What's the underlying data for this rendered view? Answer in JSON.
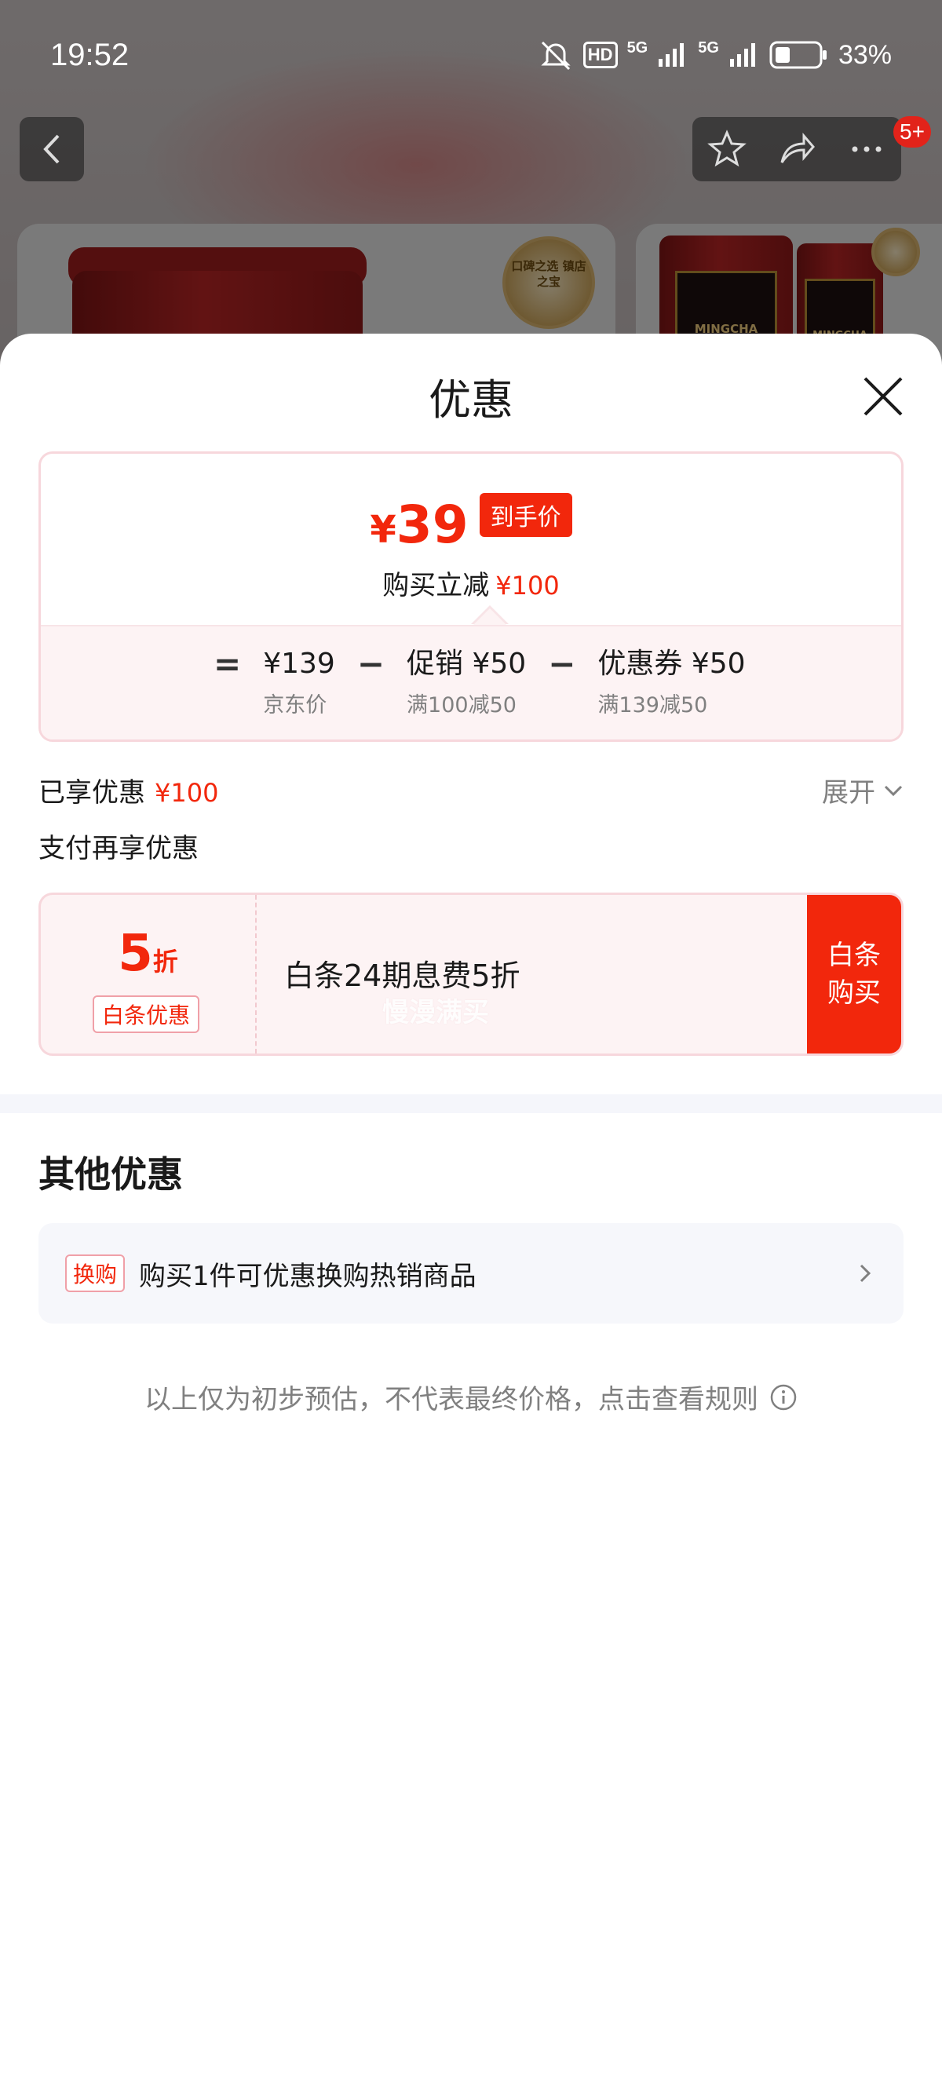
{
  "status_bar": {
    "time": "19:52",
    "battery": "33%",
    "network1": "5G",
    "network2": "5G",
    "hd": "HD"
  },
  "nav": {
    "badge": "5+"
  },
  "background": {
    "badge_text": "口碑之选 镇店之宝",
    "tin_label": "MINGCHA"
  },
  "sheet": {
    "title": "优惠",
    "price_card": {
      "final_yen": "¥",
      "final_value": "39",
      "final_tag": "到手价",
      "reduce_label": "购买立减",
      "reduce_value": "¥100",
      "op_equals": "=",
      "op_minus": "−",
      "terms": [
        {
          "main": "¥139",
          "sub": "京东价"
        },
        {
          "main": "促销 ¥50",
          "sub": "满100减50"
        },
        {
          "main": "优惠券 ¥50",
          "sub": "满139减50"
        }
      ]
    },
    "enjoyed_label": "已享优惠",
    "enjoyed_value": "¥100",
    "expand_label": "展开",
    "pay_more_label": "支付再享优惠",
    "baitiao": {
      "discount_num": "5",
      "discount_unit": "折",
      "tag": "白条优惠",
      "text": "白条24期息费5折",
      "watermark": "慢漫满买",
      "button": "白条购买"
    },
    "other_title": "其他优惠",
    "other_items": [
      {
        "tag": "换购",
        "text": "购买1件可优惠换购热销商品"
      }
    ],
    "footnote": "以上仅为初步预估，不代表最终价格，点击查看规则"
  }
}
